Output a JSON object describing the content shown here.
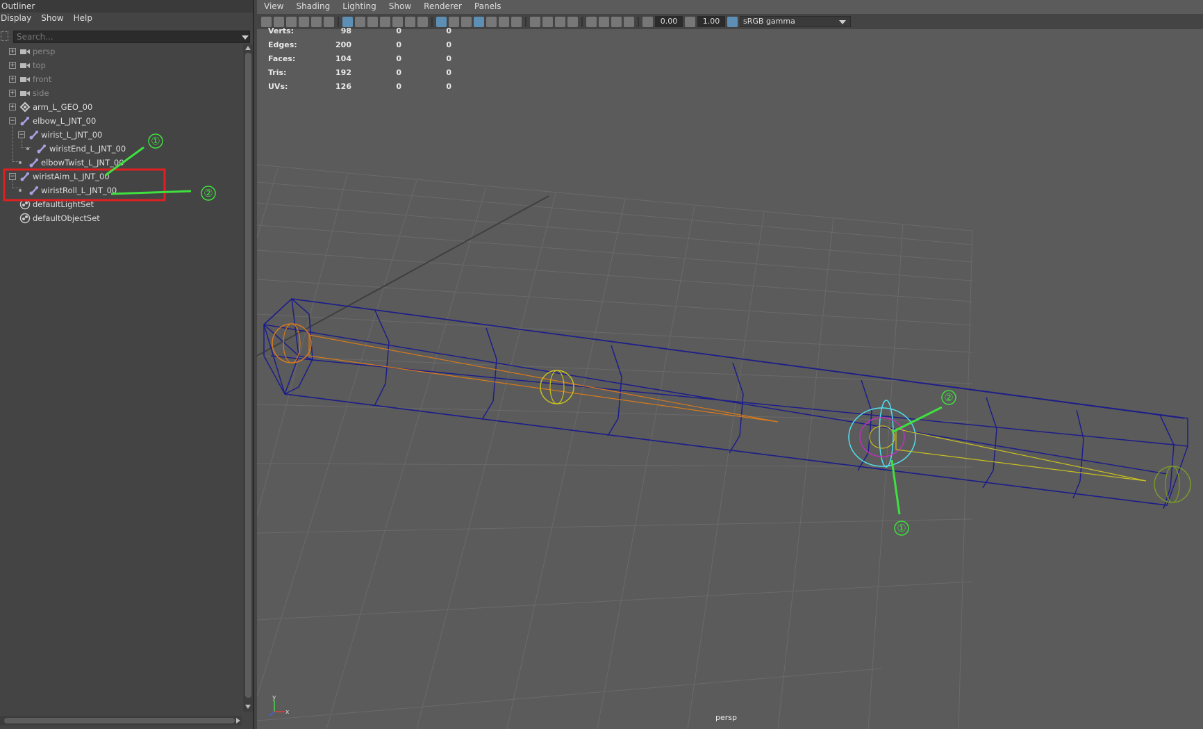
{
  "outliner": {
    "title": "Outliner",
    "menu": [
      "Display",
      "Show",
      "Help"
    ],
    "search_placeholder": "Search...",
    "items": [
      {
        "label": "persp",
        "icon": "camera-icon"
      },
      {
        "label": "top",
        "icon": "camera-icon"
      },
      {
        "label": "front",
        "icon": "camera-icon"
      },
      {
        "label": "side",
        "icon": "camera-icon"
      },
      {
        "label": "arm_L_GEO_00",
        "icon": "mesh-transform-icon"
      },
      {
        "label": "elbow_L_JNT_00",
        "icon": "joint-icon"
      },
      {
        "label": "wirist_L_JNT_00",
        "icon": "joint-icon"
      },
      {
        "label": "wiristEnd_L_JNT_00",
        "icon": "joint-icon"
      },
      {
        "label": "elbowTwist_L_JNT_00",
        "icon": "joint-icon"
      },
      {
        "label": "wiristAim_L_JNT_00",
        "icon": "joint-icon"
      },
      {
        "label": "wiristRoll_L_JNT_00",
        "icon": "joint-icon"
      },
      {
        "label": "defaultLightSet",
        "icon": "set-icon"
      },
      {
        "label": "defaultObjectSet",
        "icon": "set-icon"
      }
    ]
  },
  "viewport": {
    "menu": [
      "View",
      "Shading",
      "Lighting",
      "Show",
      "Renderer",
      "Panels"
    ],
    "toolbar": {
      "exposure": "0.00",
      "gamma": "1.00",
      "color_space": "sRGB gamma"
    },
    "heads_up": {
      "rows": [
        {
          "label": "Verts:",
          "values": [
            "98",
            "0",
            "0"
          ]
        },
        {
          "label": "Edges:",
          "values": [
            "200",
            "0",
            "0"
          ]
        },
        {
          "label": "Faces:",
          "values": [
            "104",
            "0",
            "0"
          ]
        },
        {
          "label": "Tris:",
          "values": [
            "192",
            "0",
            "0"
          ]
        },
        {
          "label": "UVs:",
          "values": [
            "126",
            "0",
            "0"
          ]
        }
      ]
    },
    "camera_name": "persp",
    "axis_labels": {
      "y": "y",
      "x": "x"
    }
  },
  "annotations": {
    "marker_1": "①",
    "marker_2": "②",
    "accent": "#3fe03f",
    "highlight": "#e02020"
  },
  "colors": {
    "mesh_wire": "#1d1d8a",
    "joint_orange": "#d87a1c",
    "joint_yellow": "#c8c020",
    "joint_cyan": "#50e0f0",
    "joint_magenta": "#c030c0"
  }
}
